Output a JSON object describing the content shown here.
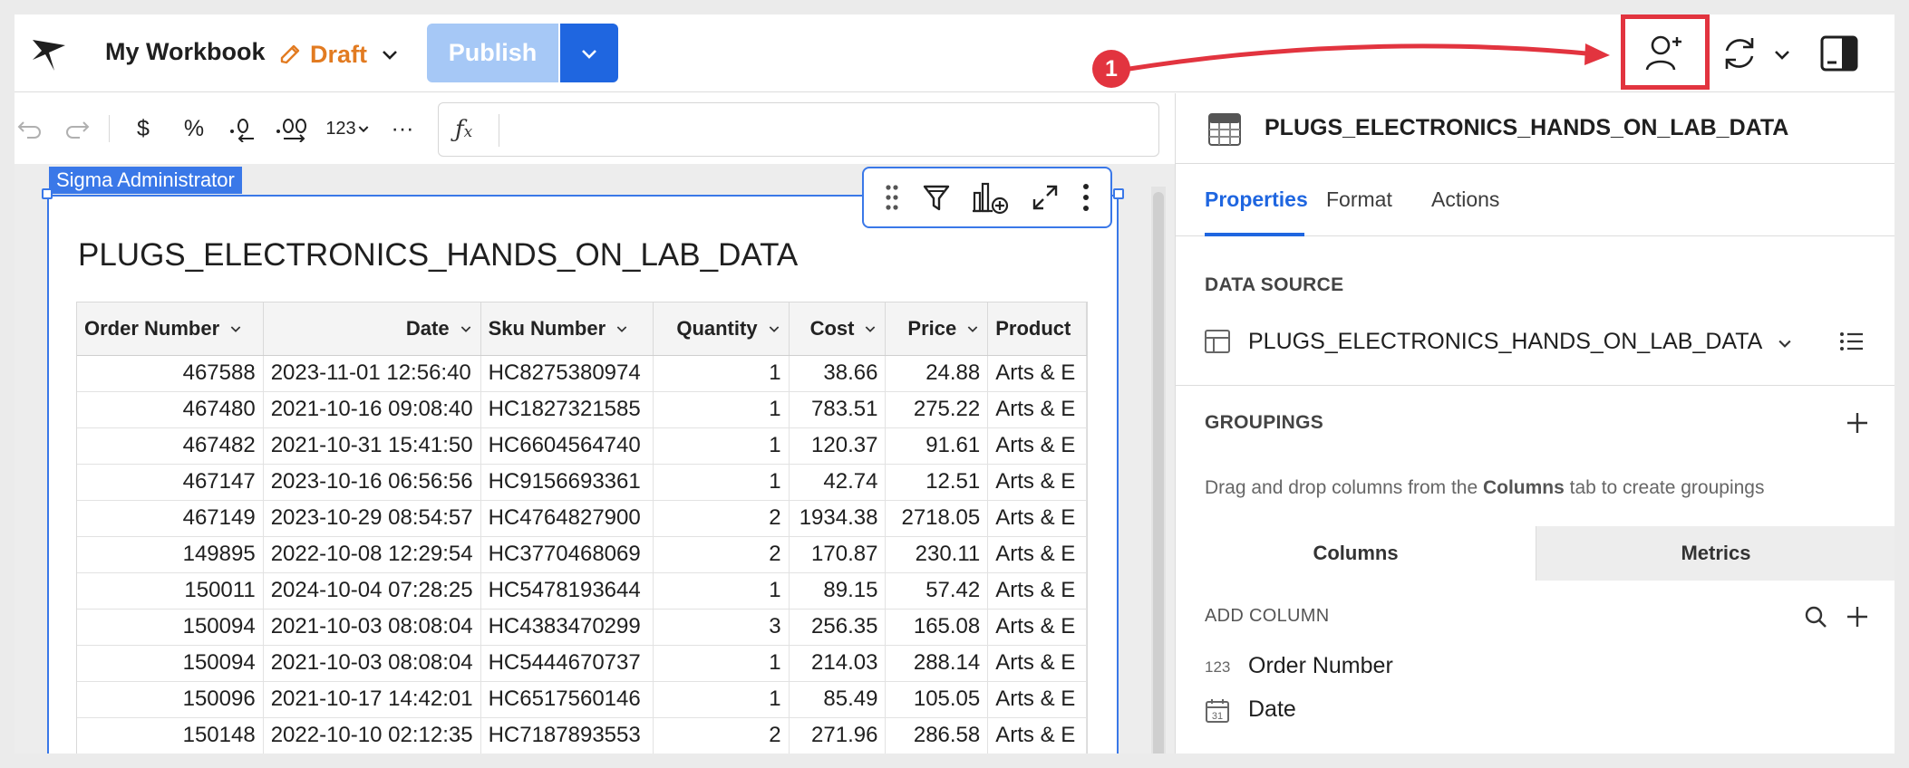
{
  "header": {
    "workbook_title": "My Workbook",
    "status_label": "Draft",
    "publish_label": "Publish",
    "callout_number": "1",
    "callout_color": "#e2343f",
    "accent_color": "#1f66e0",
    "draft_color": "#e27b21"
  },
  "toolbar": {
    "undo_icon": "undo-icon",
    "redo_icon": "redo-icon",
    "currency_label": "$",
    "percent_label": "%",
    "more_label": "···",
    "number_format_label": "123"
  },
  "canvas": {
    "element_owner_tag": "Sigma Administrator",
    "table_title": "PLUGS_ELECTRONICS_HANDS_ON_LAB_DATA",
    "columns": [
      "Order Number",
      "Date",
      "Sku Number",
      "Quantity",
      "Cost",
      "Price",
      "Product"
    ],
    "rows": [
      [
        "467588",
        "2023-11-01 12:56:40",
        "HC8275380974",
        "1",
        "38.66",
        "24.88",
        "Arts & E"
      ],
      [
        "467480",
        "2021-10-16 09:08:40",
        "HC1827321585",
        "1",
        "783.51",
        "275.22",
        "Arts & E"
      ],
      [
        "467482",
        "2021-10-31 15:41:50",
        "HC6604564740",
        "1",
        "120.37",
        "91.61",
        "Arts & E"
      ],
      [
        "467147",
        "2023-10-16 06:56:56",
        "HC9156693361",
        "1",
        "42.74",
        "12.51",
        "Arts & E"
      ],
      [
        "467149",
        "2023-10-29 08:54:57",
        "HC4764827900",
        "2",
        "1934.38",
        "2718.05",
        "Arts & E"
      ],
      [
        "149895",
        "2022-10-08 12:29:54",
        "HC3770468069",
        "2",
        "170.87",
        "230.11",
        "Arts & E"
      ],
      [
        "150011",
        "2024-10-04 07:28:25",
        "HC5478193644",
        "1",
        "89.15",
        "57.42",
        "Arts & E"
      ],
      [
        "150094",
        "2021-10-03 08:08:04",
        "HC4383470299",
        "3",
        "256.35",
        "165.08",
        "Arts & E"
      ],
      [
        "150094",
        "2021-10-03 08:08:04",
        "HC5444670737",
        "1",
        "214.03",
        "288.14",
        "Arts & E"
      ],
      [
        "150096",
        "2021-10-17 14:42:01",
        "HC6517560146",
        "1",
        "85.49",
        "105.05",
        "Arts & E"
      ],
      [
        "150148",
        "2022-10-10 02:12:35",
        "HC7187893553",
        "2",
        "271.96",
        "286.58",
        "Arts & E"
      ]
    ]
  },
  "panel": {
    "title": "PLUGS_ELECTRONICS_HANDS_ON_LAB_DATA",
    "tabs": [
      "Properties",
      "Format",
      "Actions"
    ],
    "data_source_label": "DATA SOURCE",
    "data_source_name": "PLUGS_ELECTRONICS_HANDS_ON_LAB_DATA",
    "groupings_label": "GROUPINGS",
    "groupings_hint_pre": "Drag and drop columns from the ",
    "groupings_hint_bold": "Columns",
    "groupings_hint_post": " tab to create groupings",
    "column_tabs": [
      "Columns",
      "Metrics"
    ],
    "add_column_label": "ADD COLUMN",
    "column_items": [
      {
        "type_label": "123",
        "name": "Order Number"
      },
      {
        "type_label": "31",
        "name": "Date"
      }
    ]
  }
}
